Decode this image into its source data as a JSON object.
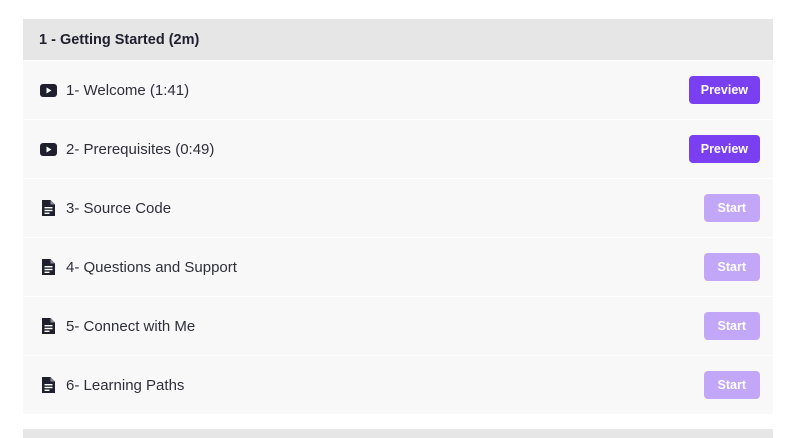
{
  "section": {
    "title": "1 - Getting Started (2m)"
  },
  "lessons": [
    {
      "icon": "video-play-icon",
      "title": "1- Welcome (1:41)",
      "button": "Preview",
      "button_type": "preview"
    },
    {
      "icon": "video-play-icon",
      "title": "2- Prerequisites (0:49)",
      "button": "Preview",
      "button_type": "preview"
    },
    {
      "icon": "document-icon",
      "title": "3- Source Code",
      "button": "Start",
      "button_type": "start"
    },
    {
      "icon": "document-icon",
      "title": "4- Questions and Support",
      "button": "Start",
      "button_type": "start"
    },
    {
      "icon": "document-icon",
      "title": "5- Connect with Me",
      "button": "Start",
      "button_type": "start"
    },
    {
      "icon": "document-icon",
      "title": "6- Learning Paths",
      "button": "Start",
      "button_type": "start"
    }
  ],
  "colors": {
    "accent": "#7b3ff2",
    "accent_light": "#c2a6f8",
    "header_bg": "#e6e6e6",
    "row_bg": "#f8f8f8"
  }
}
